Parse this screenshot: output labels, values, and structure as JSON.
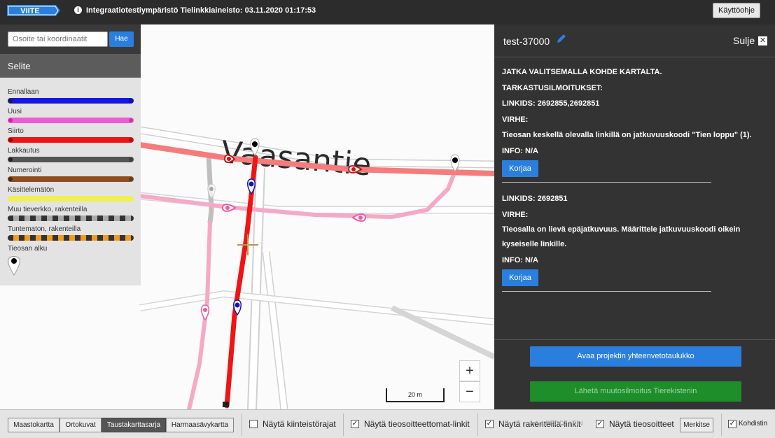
{
  "topbar": {
    "logo_text": "VIITE",
    "env_title": "Integraatiotestiympäristö Tielinkkiaineisto: 03.11.2020 01:17:53",
    "help_label": "Käyttöohje"
  },
  "search": {
    "placeholder": "Osoite tai koordinaatit",
    "button_label": "Hae"
  },
  "legend": {
    "title": "Selite",
    "items": [
      {
        "label": "Ennallaan",
        "color": "#1414e6"
      },
      {
        "label": "Uusi",
        "color": "#f05ad2"
      },
      {
        "label": "Siirto",
        "color": "#f01414"
      },
      {
        "label": "Lakkautus",
        "color": "#555555"
      },
      {
        "label": "Numerointi",
        "color": "#8b4f23"
      },
      {
        "label": "Käsittelemätön",
        "color": "#f0f050"
      },
      {
        "label": "Muu tieverkko, rakenteilla",
        "color": "#9a9a9a"
      },
      {
        "label": "Tuntematon, rakenteilla",
        "color": "#f59a14"
      },
      {
        "label": "Tieosan alku",
        "color": "#000000"
      }
    ]
  },
  "map": {
    "street_label": "Vaasantie",
    "scale_label": "20 m",
    "zoom_in": "+",
    "zoom_out": "−"
  },
  "panel": {
    "project_name": "test-37000",
    "close_label": "Sulje",
    "close_icon": "✕",
    "instruction": "JATKA VALITSEMALLA KOHDE KARTALTA.",
    "checks_title": "TARKASTUSILMOITUKSET:",
    "notices": [
      {
        "linkids": "LINKIDS: 2692855,2692851",
        "error_title": "VIRHE:",
        "error_text": "Tieosan keskellä olevalla linkillä on jatkuvuuskoodi \"Tien loppu\" (1).",
        "info": "INFO: N/A",
        "fix_label": "Korjaa"
      },
      {
        "linkids": "LINKIDS: 2692851",
        "error_title": "VIRHE:",
        "error_text": "Tieosalla on lievä epäjatkuvuus. Määrittele jatkuvuuskoodi oikein kyseiselle linkille.",
        "info": "INFO: N/A",
        "fix_label": "Korjaa"
      }
    ],
    "summary_button": "Avaa projektin yhteenvetotaulukko",
    "send_button": "Lähetä muutosilmoitus Tierekisteriin"
  },
  "bottombar": {
    "layers": [
      "Maastokartta",
      "Ortokuvat",
      "Taustakarttasarja",
      "Harmaasävykartta"
    ],
    "active_layer": "Taustakarttasarja",
    "checkboxes": [
      {
        "label": "Näytä kiinteistörajat",
        "checked": false
      },
      {
        "label": "Näytä tieosoitteettomat-linkit",
        "checked": true
      },
      {
        "label": "Näytä rakenteilla-linkit",
        "checked": true
      },
      {
        "label": "Näytä tieosoitteet",
        "checked": true
      }
    ],
    "version_text": "v1.4 PROD2 | FIN",
    "mark_label": "Merkitse",
    "kohdistin_label": "Kohdistin",
    "kohdistin_checked": true
  }
}
